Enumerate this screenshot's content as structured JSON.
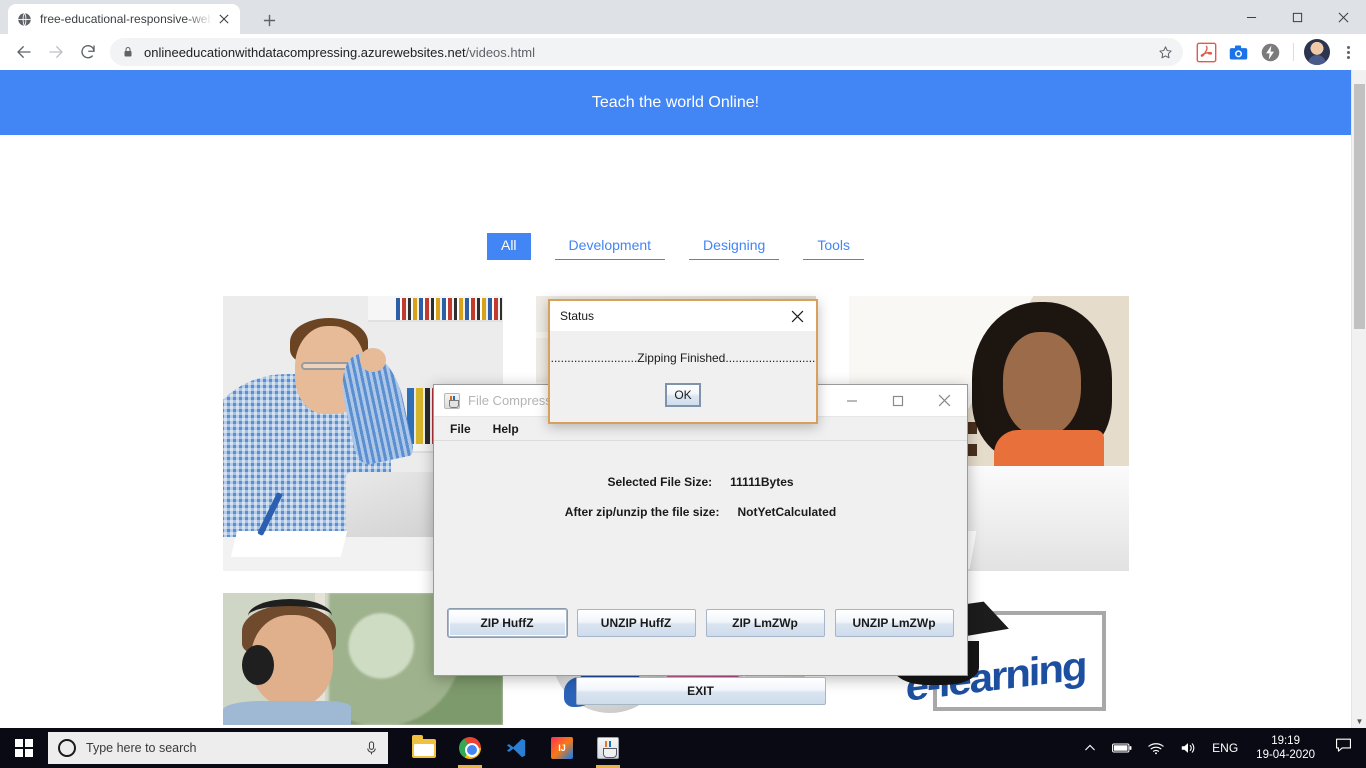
{
  "browser": {
    "tab": {
      "title": "free-educational-responsive-web",
      "favicon_icon": "globe-icon",
      "close_icon": "close-icon"
    },
    "new_tab_label": "+",
    "window_controls": {
      "minimize": "—",
      "maximize": "☐",
      "close": "✕"
    },
    "nav": {
      "back_icon": "arrow-left-icon",
      "forward_icon": "arrow-right-icon",
      "reload_icon": "reload-icon"
    },
    "omnibox": {
      "lock_icon": "lock-icon",
      "url_domain": "onlineeducationwithdatacompressing.azurewebsites.net",
      "url_path": "/videos.html",
      "star_icon": "star-icon"
    },
    "extensions": [
      {
        "name": "adobe-acrobat-extension-icon",
        "glyph": "A"
      },
      {
        "name": "screenshot-camera-extension-icon",
        "glyph": "▣"
      },
      {
        "name": "lightning-bolt-extension-icon",
        "glyph": "⚡"
      }
    ],
    "profile_avatar": "avatar",
    "menu_icon": "kebab-menu-icon"
  },
  "page": {
    "hero_title": "Teach the world Online!",
    "filters": [
      {
        "label": "All",
        "active": true
      },
      {
        "label": "Development",
        "active": false
      },
      {
        "label": "Designing",
        "active": false
      },
      {
        "label": "Tools",
        "active": false
      }
    ],
    "gallery": {
      "row1": [
        {
          "alt": "man-with-glasses-at-laptop"
        },
        {
          "alt": "student-with-headphones"
        },
        {
          "alt": "woman-working-on-laptop"
        }
      ],
      "row2": [
        {
          "alt": "man-with-headphones-by-window"
        },
        {
          "alt": "globe-monitor-and-sphere"
        },
        {
          "alt": "e-learning-graduation-cap"
        }
      ]
    },
    "elearn_word": "e-learning",
    "scrollbar": {
      "down_arrow": "▼"
    }
  },
  "java_window": {
    "icon": "java-coffee-cup-icon",
    "title": "File Compresser",
    "window_controls": {
      "minimize": "—",
      "maximize": "☐",
      "close": "✕"
    },
    "menus": [
      {
        "label": "File"
      },
      {
        "label": "Help"
      }
    ],
    "fields": [
      {
        "label": "Selected File Size:",
        "value": "11111Bytes"
      },
      {
        "label": "After zip/unzip the file size:",
        "value": "NotYetCalculated"
      }
    ],
    "action_buttons": [
      {
        "label": "ZIP HuffZ",
        "focused": true
      },
      {
        "label": "UNZIP HuffZ",
        "focused": false
      },
      {
        "label": "ZIP LmZWp",
        "focused": false
      },
      {
        "label": "UNZIP LmZWp",
        "focused": false
      }
    ],
    "exit_button": "EXIT"
  },
  "status_dialog": {
    "title": "Status",
    "close_icon": "close-icon",
    "message": "..........................Zipping Finished...........................",
    "ok_button": "OK",
    "border_color": "#d9a05b"
  },
  "taskbar": {
    "start_icon": "windows-start-icon",
    "search_placeholder": "Type here to search",
    "cortana_icon": "cortana-circle-icon",
    "mic_icon": "microphone-icon",
    "pinned": [
      {
        "name": "file-explorer-icon"
      },
      {
        "name": "google-chrome-icon"
      },
      {
        "name": "vs-code-icon"
      },
      {
        "name": "intellij-idea-icon"
      },
      {
        "name": "java-app-icon"
      }
    ],
    "tray": {
      "show_hidden_icon": "chevron-up-icon",
      "battery_icon": "battery-icon",
      "wifi_icon": "wifi-icon",
      "volume_icon": "volume-icon",
      "language": "ENG",
      "time": "19:19",
      "date": "19-04-2020",
      "action_center_icon": "action-center-icon"
    }
  },
  "colors": {
    "hero_blue": "#4285f4",
    "dialog_border": "#d9a05b",
    "taskbar": "#0a0a14"
  }
}
